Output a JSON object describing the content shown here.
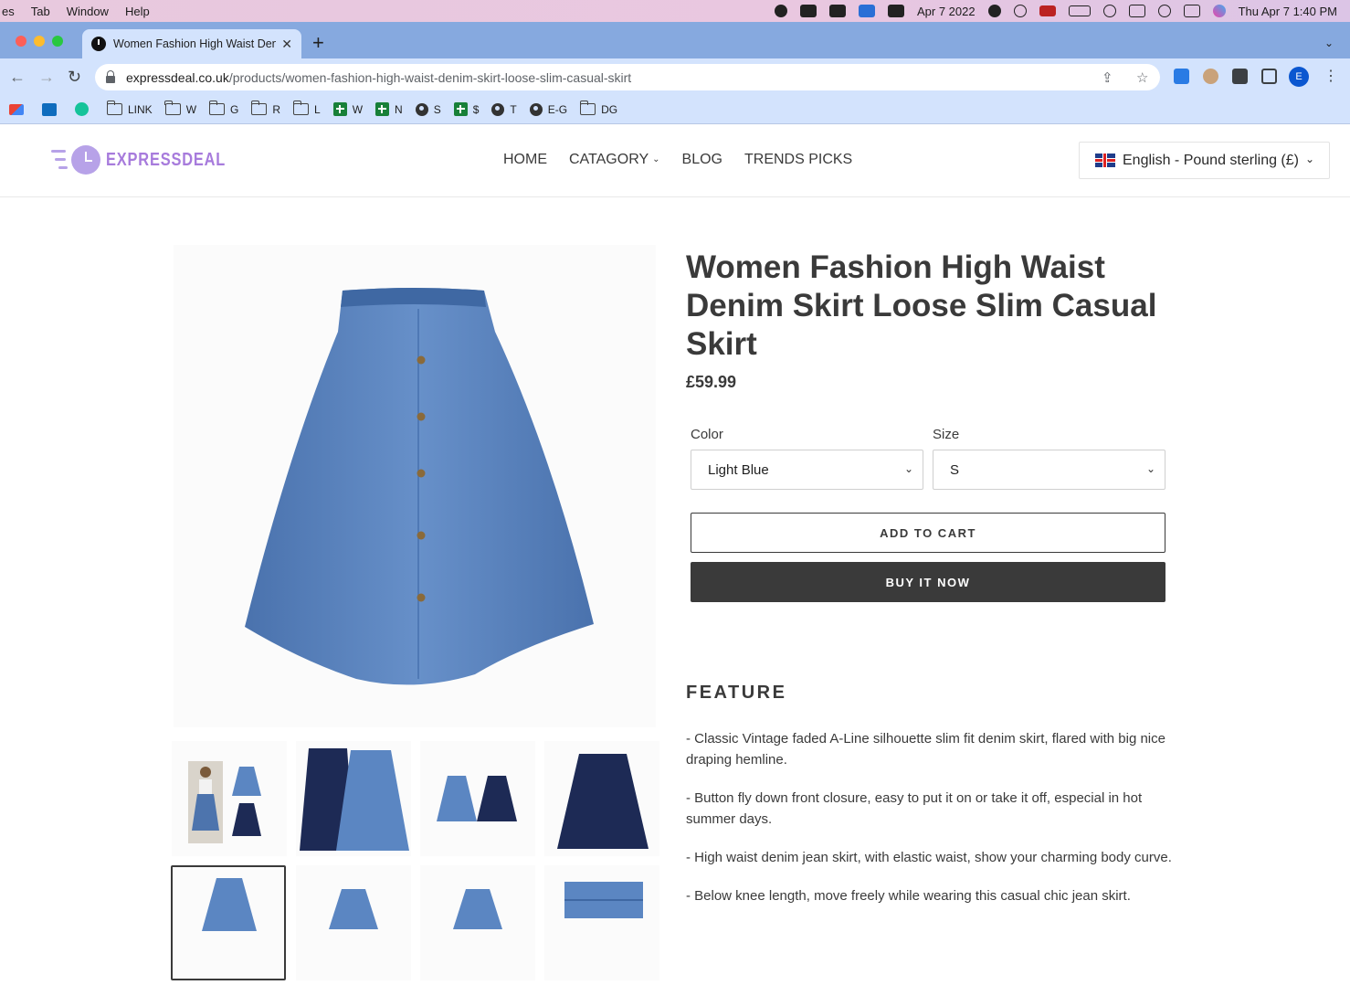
{
  "macos_menubar": {
    "menus": [
      "es",
      "Tab",
      "Window",
      "Help"
    ],
    "date_widget": "Apr 7 2022",
    "clock": "Thu Apr 7  1:40 PM"
  },
  "browser": {
    "tab_title": "Women Fashion High Waist Denim Skirt Loose Slim Casual Skirt",
    "url_host": "expressdeal.co.uk",
    "url_path": "/products/women-fashion-high-waist-denim-skirt-loose-slim-casual-skirt",
    "profile_initial": "E",
    "bookmarks": [
      {
        "icon": "gmail-icon",
        "label": ""
      },
      {
        "icon": "outlook-icon",
        "label": ""
      },
      {
        "icon": "grammarly-icon",
        "label": ""
      },
      {
        "icon": "folder-icon",
        "label": "LINK"
      },
      {
        "icon": "folder-icon",
        "label": "W"
      },
      {
        "icon": "folder-icon",
        "label": "G"
      },
      {
        "icon": "folder-icon",
        "label": "R"
      },
      {
        "icon": "folder-icon",
        "label": "L"
      },
      {
        "icon": "sheets-icon",
        "label": "W"
      },
      {
        "icon": "sheets-icon",
        "label": "N"
      },
      {
        "icon": "globe-icon",
        "label": "S"
      },
      {
        "icon": "sheets-icon",
        "label": "$"
      },
      {
        "icon": "globe-icon",
        "label": "T"
      },
      {
        "icon": "globe-icon",
        "label": "E-G"
      },
      {
        "icon": "folder-icon",
        "label": "DG"
      }
    ]
  },
  "site": {
    "logo_text": "EXPRESSDEAL",
    "nav": [
      "HOME",
      "CATAGORY",
      "BLOG",
      "TRENDS PICKS"
    ],
    "locale_selector": "English - Pound sterling (£)"
  },
  "product": {
    "title": "Women Fashion High Waist Denim Skirt Loose Slim Casual Skirt",
    "price": "£59.99",
    "color_label": "Color",
    "color_value": "Light Blue",
    "size_label": "Size",
    "size_value": "S",
    "add_to_cart": "ADD TO CART",
    "buy_now": "BUY IT NOW",
    "feature_heading": "FEATURE",
    "features": [
      "- Classic Vintage faded A-Line silhouette slim fit denim skirt, flared with big nice draping hemline.",
      "- Button fly down front closure, easy to put it on or take it off, especial in hot summer days.",
      "- High waist denim jean skirt, with elastic waist, show your charming body curve.",
      "- Below knee length, move freely while wearing this casual chic jean skirt."
    ]
  },
  "colors": {
    "denim_light": "#5b86c2",
    "denim_dark": "#1d2a55",
    "button_dark": "#3a3a3a",
    "brand_purple": "#a77bdc"
  }
}
